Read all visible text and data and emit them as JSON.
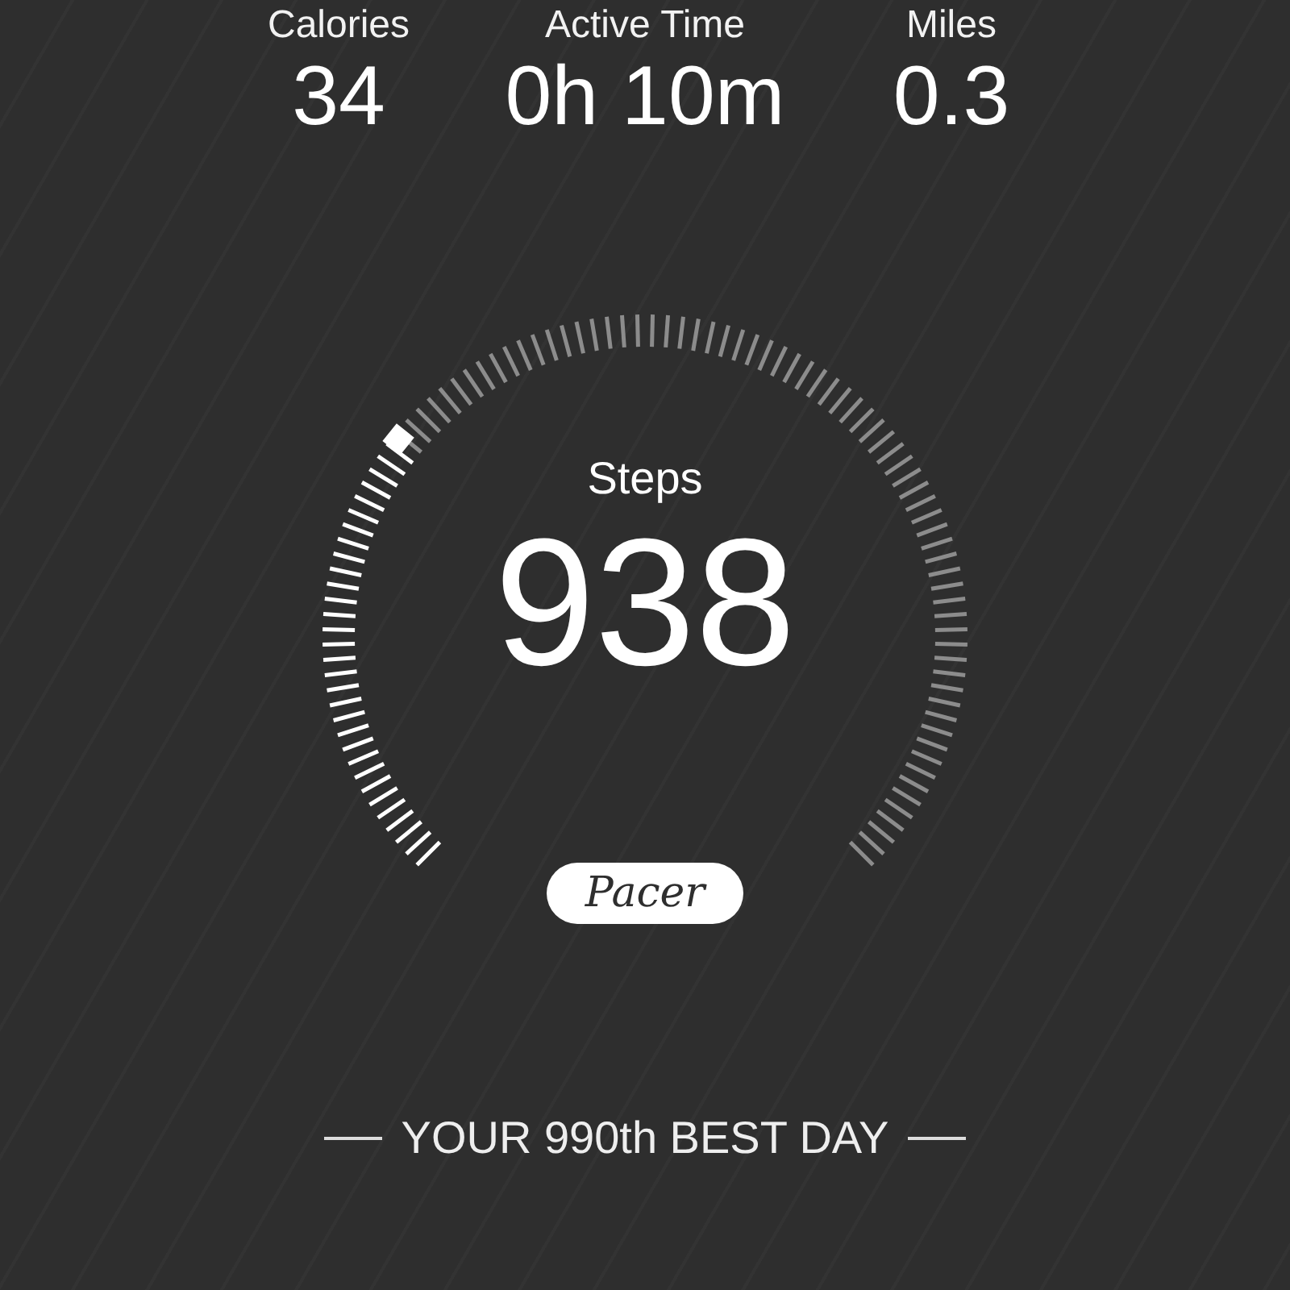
{
  "stats": [
    {
      "label": "Calories",
      "value": "34"
    },
    {
      "label": "Active Time",
      "value": "0h 10m"
    },
    {
      "label": "Miles",
      "value": "0.3"
    }
  ],
  "gauge": {
    "label": "Steps",
    "value": "938"
  },
  "logo": "Pacer",
  "best_day": "YOUR 990th BEST DAY"
}
